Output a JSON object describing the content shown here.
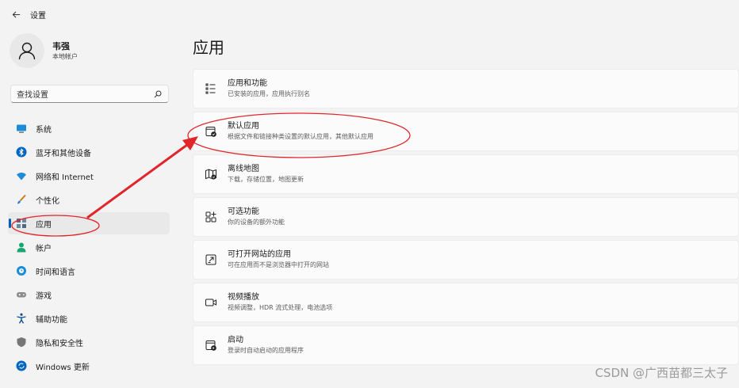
{
  "window": {
    "title": "设置"
  },
  "user": {
    "name": "韦强",
    "account_type": "本地帐户"
  },
  "search": {
    "placeholder": "查找设置"
  },
  "nav": {
    "items": [
      {
        "label": "系统",
        "icon": "monitor-icon"
      },
      {
        "label": "蓝牙和其他设备",
        "icon": "bluetooth-icon"
      },
      {
        "label": "网络和 Internet",
        "icon": "wifi-icon"
      },
      {
        "label": "个性化",
        "icon": "brush-icon"
      },
      {
        "label": "应用",
        "icon": "apps-icon"
      },
      {
        "label": "帐户",
        "icon": "person-icon"
      },
      {
        "label": "时间和语言",
        "icon": "globe-clock-icon"
      },
      {
        "label": "游戏",
        "icon": "gamepad-icon"
      },
      {
        "label": "辅助功能",
        "icon": "accessibility-icon"
      },
      {
        "label": "隐私和安全性",
        "icon": "shield-icon"
      },
      {
        "label": "Windows 更新",
        "icon": "update-icon"
      }
    ],
    "active": "应用"
  },
  "main": {
    "title": "应用",
    "cards": [
      {
        "title": "应用和功能",
        "description": "已安装的应用，应用执行别名",
        "icon": "list-icon"
      },
      {
        "title": "默认应用",
        "description": "根据文件和链接种类设置的默认应用，其他默认应用",
        "icon": "default-apps-icon"
      },
      {
        "title": "离线地图",
        "description": "下载，存储位置，地图更新",
        "icon": "map-icon"
      },
      {
        "title": "可选功能",
        "description": "你的设备的额外功能",
        "icon": "optional-features-icon"
      },
      {
        "title": "可打开网站的应用",
        "description": "可在应用而不是浏览器中打开的网站",
        "icon": "open-external-icon"
      },
      {
        "title": "视频播放",
        "description": "视频调整，HDR 流式处理，电池选项",
        "icon": "video-icon"
      },
      {
        "title": "启动",
        "description": "登录时自动启动的应用程序",
        "icon": "startup-icon"
      }
    ]
  },
  "watermark": "CSDN @广西苗都三太子",
  "colors": {
    "accent": "#005fb8",
    "annotation": "#e0262a"
  }
}
